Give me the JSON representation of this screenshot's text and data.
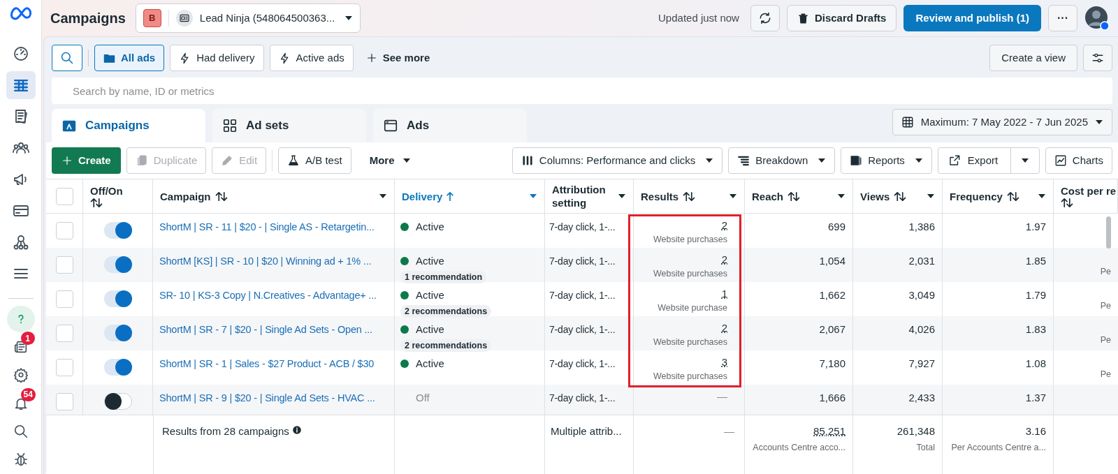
{
  "sidebar": {
    "items": [
      {
        "kind": "gauge",
        "selected": false
      },
      {
        "kind": "table",
        "selected": true
      },
      {
        "kind": "pages",
        "selected": false
      },
      {
        "kind": "people",
        "selected": false
      },
      {
        "kind": "megaphone",
        "selected": false
      },
      {
        "kind": "card",
        "selected": false
      },
      {
        "kind": "network",
        "selected": false
      },
      {
        "kind": "menu",
        "selected": false
      }
    ],
    "bottom_items": [
      {
        "kind": "help"
      },
      {
        "kind": "news",
        "badge": "1"
      },
      {
        "kind": "gear"
      },
      {
        "kind": "bell",
        "badge": "54"
      },
      {
        "kind": "search"
      },
      {
        "kind": "bug"
      }
    ]
  },
  "header": {
    "title": "Campaigns",
    "account": {
      "badge": "B",
      "name": "Lead Ninja (548064500363..."
    },
    "updated": "Updated just now",
    "discard": "Discard Drafts",
    "publish": "Review and publish (1)",
    "more": "···"
  },
  "filters": {
    "chips": [
      {
        "label": "All ads",
        "selected": true
      },
      {
        "label": "Had delivery",
        "selected": false
      },
      {
        "label": "Active ads",
        "selected": false
      }
    ],
    "see_more": "See more",
    "create_view": "Create a view"
  },
  "search": {
    "placeholder": "Search by name, ID or metrics"
  },
  "tabs": [
    {
      "label": "Campaigns",
      "selected": true
    },
    {
      "label": "Ad sets",
      "selected": false
    },
    {
      "label": "Ads",
      "selected": false
    }
  ],
  "date_range": "Maximum: 7 May 2022 - 7 Jun 2025",
  "toolbar": [
    {
      "label": "Create",
      "kind": "primary",
      "disabled": false
    },
    {
      "label": "Duplicate",
      "kind": "plain",
      "disabled": true
    },
    {
      "label": "Edit",
      "kind": "plain",
      "disabled": true
    },
    {
      "label": "A/B test",
      "kind": "plain",
      "disabled": false
    },
    {
      "label": "More",
      "kind": "menu",
      "disabled": false
    },
    {
      "label": "Columns: Performance and clicks",
      "kind": "dropdown",
      "disabled": false
    },
    {
      "label": "Breakdown",
      "kind": "dropdown",
      "disabled": false
    },
    {
      "label": "Reports",
      "kind": "dropdown",
      "disabled": false
    },
    {
      "label": "Export",
      "kind": "split",
      "disabled": false
    },
    {
      "label": "Charts",
      "kind": "plain",
      "disabled": false
    }
  ],
  "table": {
    "select_all": {
      "checked": false
    },
    "columns": [
      {
        "label": "Off/On",
        "kind": "sortable",
        "menu": false,
        "active": false
      },
      {
        "label": "Campaign",
        "kind": "sortable",
        "menu": true,
        "active": false
      },
      {
        "label": "Delivery",
        "kind": "sorted",
        "menu": true,
        "active": true
      },
      {
        "label": "Attribution setting",
        "kind": "plain",
        "menu": true,
        "active": false
      },
      {
        "label": "Results",
        "kind": "sortable",
        "menu": true,
        "active": false
      },
      {
        "label": "Reach",
        "kind": "sortable",
        "menu": true,
        "active": false
      },
      {
        "label": "Views",
        "kind": "sortable",
        "menu": true,
        "active": false
      },
      {
        "label": "Frequency",
        "kind": "sortable",
        "menu": true,
        "active": false
      },
      {
        "label": "Cost per re",
        "kind": "sortable",
        "menu": false,
        "active": false
      }
    ],
    "rows": [
      {
        "checked": false,
        "on": true,
        "campaign": "ShortM | SR - 11 | $20 - | Single AS - Retargetin...",
        "status_dot": true,
        "delivery": "Active",
        "attribution": "7-day click, 1-...",
        "result": "2",
        "result_label": "Website purchases",
        "reach": "699",
        "views": "1,386",
        "frequency": "1.97"
      },
      {
        "checked": false,
        "on": true,
        "campaign": "ShortM [KS] | SR - 10 | $20 | Winning ad + 1% ...",
        "status_dot": true,
        "delivery": "Active",
        "recommendation": "1 recommendation",
        "attribution": "7-day click, 1-...",
        "result": "2",
        "result_label": "Website purchases",
        "reach": "1,054",
        "views": "2,031",
        "frequency": "1.85",
        "cost": "Pe"
      },
      {
        "checked": false,
        "on": true,
        "campaign": "SR- 10 | KS-3 Copy | N.Creatives - Advantage+ ...",
        "status_dot": true,
        "delivery": "Active",
        "recommendation": "2 recommendations",
        "attribution": "7-day click, 1-...",
        "result": "1",
        "result_label": "Website purchase",
        "reach": "1,662",
        "views": "3,049",
        "frequency": "1.79",
        "cost": "Pe"
      },
      {
        "checked": false,
        "on": true,
        "campaign": "ShortM | SR - 7 | $20 - | Single Ad Sets - Open ...",
        "status_dot": true,
        "delivery": "Active",
        "recommendation": "2 recommendations",
        "attribution": "7-day click, 1-...",
        "result": "2",
        "result_label": "Website purchases",
        "reach": "2,067",
        "views": "4,026",
        "frequency": "1.83",
        "cost": "Pe"
      },
      {
        "checked": false,
        "on": true,
        "campaign": "ShortM | SR - 1 | Sales - $27 Product - ACB / $30",
        "status_dot": true,
        "delivery": "Active",
        "attribution": "7-day click, 1-...",
        "result": "3",
        "result_label": "Website purchases",
        "reach": "7,180",
        "views": "7,927",
        "frequency": "1.08",
        "cost": "Pe"
      },
      {
        "checked": false,
        "on": false,
        "campaign": "ShortM | SR - 9 | $20 - | Single Ad Sets - HVAC ...",
        "status_dot": false,
        "delivery": "Off",
        "attribution": "7-day click, 1-...",
        "result": "—",
        "reach": "1,666",
        "views": "2,433",
        "frequency": "1.37"
      }
    ],
    "footer": {
      "summary": "Results from 28 campaigns",
      "attribution": "Multiple attrib...",
      "result": "—",
      "reach": "85,251",
      "reach_label": "Accounts Centre acco...",
      "views": "261,348",
      "views_label": "Total",
      "frequency": "3.16",
      "frequency_label": "Per Accounts Centre a..."
    }
  }
}
